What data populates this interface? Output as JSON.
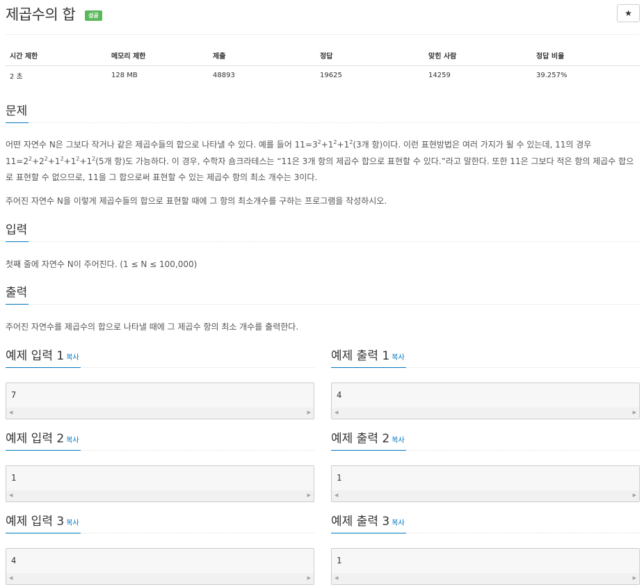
{
  "header": {
    "title": "제곱수의 합",
    "badge": "성공",
    "star_icon": "★"
  },
  "info_table": {
    "columns": [
      "시간 제한",
      "메모리 제한",
      "제출",
      "정답",
      "맞힌 사람",
      "정답 비율"
    ],
    "values": [
      "2 초",
      "128 MB",
      "48893",
      "19625",
      "14259",
      "39.257%"
    ]
  },
  "problem": {
    "heading": "문제",
    "p1": {
      "a": "어떤 자연수 N은 그보다 작거나 같은 제곱수들의 합으로 나타낼 수 있다. 예를 들어 11=3",
      "b": "+1",
      "c": "+1",
      "d": "(3개 항)이다. 이런 표현방법은 여러 가지가 될 수 있는데, 11의 경우",
      "e": "11=2",
      "f": "+2",
      "g": "+1",
      "h": "+1",
      "i": "+1",
      "j": "(5개 항)도 가능하다. 이 경우, 수학자 숌크라테스는 “11은 3개 항의 제곱수 합으로 표현할 수 있다.”라고 말한다. 또한 11은 그보다 적은 항의 제곱수 합으로 표현할 수 없으므로, 11을 그 합으로써 표현할 수 있는 제곱수 항의 최소 개수는 3이다.",
      "sup": "2"
    },
    "p2": "주어진 자연수 N을 이렇게 제곱수들의 합으로 표현할 때에 그 항의 최소개수를 구하는 프로그램을 작성하시오."
  },
  "input": {
    "heading": "입력",
    "text": "첫째 줄에 자연수 N이 주어진다. (1 ≤ N ≤ 100,000)"
  },
  "output": {
    "heading": "출력",
    "text": "주어진 자연수를 제곱수의 합으로 나타낼 때에 그 제곱수 항의 최소 개수를 출력한다."
  },
  "samples": {
    "copy_label": "복사",
    "arrow_left": "◀",
    "arrow_right": "▶",
    "items": [
      {
        "in_title": "예제 입력 1",
        "out_title": "예제 출력 1",
        "in": "7",
        "out": "4"
      },
      {
        "in_title": "예제 입력 2",
        "out_title": "예제 출력 2",
        "in": "1",
        "out": "1"
      },
      {
        "in_title": "예제 입력 3",
        "out_title": "예제 출력 3",
        "in": "4",
        "out": "1"
      }
    ]
  },
  "colors": {
    "accent": "#0076c0",
    "success": "#5cb85c"
  }
}
